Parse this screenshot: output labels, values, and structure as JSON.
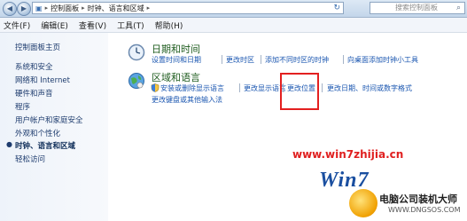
{
  "address_bar": {
    "crumbs": [
      "控制面板",
      "时钟、语言和区域"
    ],
    "search_placeholder": "搜索控制面板"
  },
  "menu": [
    "文件(F)",
    "编辑(E)",
    "查看(V)",
    "工具(T)",
    "帮助(H)"
  ],
  "sidebar": {
    "items": [
      "控制面板主页",
      "系统和安全",
      "网络和 Internet",
      "硬件和声音",
      "程序",
      "用户帐户和家庭安全",
      "外观和个性化",
      "时钟、语言和区域",
      "轻松访问"
    ],
    "selected": "时钟、语言和区域"
  },
  "categories": {
    "datetime": {
      "title": "日期和时间",
      "links": [
        "设置时间和日期",
        "更改时区",
        "添加不同时区的时钟",
        "向桌面添加时钟小工具"
      ]
    },
    "region": {
      "title": "区域和语言",
      "links": [
        "安装或删除显示语言",
        "更改显示语言",
        "更改位置",
        "更改日期、时间或数字格式",
        "更改键盘或其他输入法"
      ]
    }
  },
  "watermark": {
    "url": "www.win7zhijia.cn",
    "logo": "Win7",
    "brand": "电脑公司装机大师",
    "domain": "WWW.DNGSOS.COM"
  },
  "colors": {
    "highlight_box": "#e32020",
    "link": "#1a56b0",
    "category_title": "#1f5c1f"
  }
}
